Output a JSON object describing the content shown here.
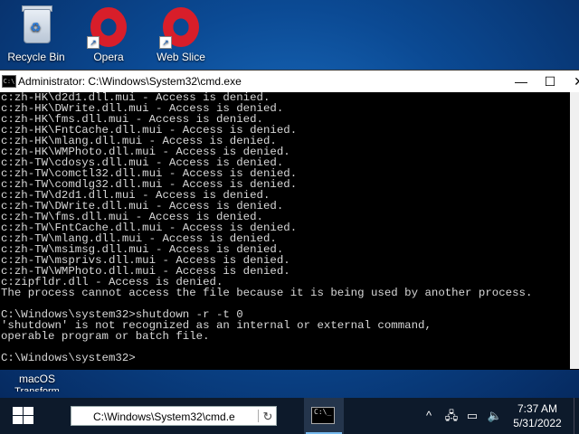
{
  "desktop": {
    "icons": [
      {
        "label": "Recycle Bin",
        "icon": "recycle-bin-icon"
      },
      {
        "label": "Opera",
        "icon": "opera-icon"
      },
      {
        "label": "Web Slice",
        "icon": "opera-icon"
      }
    ],
    "partial_icon": {
      "label_line1": "macOS",
      "label_line2": "Transform"
    }
  },
  "window": {
    "title": "Administrator: C:\\Windows\\System32\\cmd.exe",
    "icon_text": "C:\\",
    "minimize": "—",
    "maximize": "☐",
    "close": "✕"
  },
  "console": {
    "lines": [
      "c:zh-HK\\d2d1.dll.mui - Access is denied.",
      "c:zh-HK\\DWrite.dll.mui - Access is denied.",
      "c:zh-HK\\fms.dll.mui - Access is denied.",
      "c:zh-HK\\FntCache.dll.mui - Access is denied.",
      "c:zh-HK\\mlang.dll.mui - Access is denied.",
      "c:zh-HK\\WMPhoto.dll.mui - Access is denied.",
      "c:zh-TW\\cdosys.dll.mui - Access is denied.",
      "c:zh-TW\\comctl32.dll.mui - Access is denied.",
      "c:zh-TW\\comdlg32.dll.mui - Access is denied.",
      "c:zh-TW\\d2d1.dll.mui - Access is denied.",
      "c:zh-TW\\DWrite.dll.mui - Access is denied.",
      "c:zh-TW\\fms.dll.mui - Access is denied.",
      "c:zh-TW\\FntCache.dll.mui - Access is denied.",
      "c:zh-TW\\mlang.dll.mui - Access is denied.",
      "c:zh-TW\\msimsg.dll.mui - Access is denied.",
      "c:zh-TW\\msprivs.dll.mui - Access is denied.",
      "c:zh-TW\\WMPhoto.dll.mui - Access is denied.",
      "c:zipfldr.dll - Access is denied.",
      "The process cannot access the file because it is being used by another process.",
      "",
      "C:\\Windows\\system32>shutdown -r -t 0",
      "'shutdown' is not recognized as an internal or external command,",
      "operable program or batch file.",
      "",
      "C:\\Windows\\system32>"
    ]
  },
  "taskbar": {
    "search_value": "C:\\Windows\\System32\\cmd.e",
    "refresh_icon": "refresh-icon",
    "tray": {
      "chevron": "^",
      "time": "7:37 AM",
      "date": "5/31/2022"
    }
  }
}
